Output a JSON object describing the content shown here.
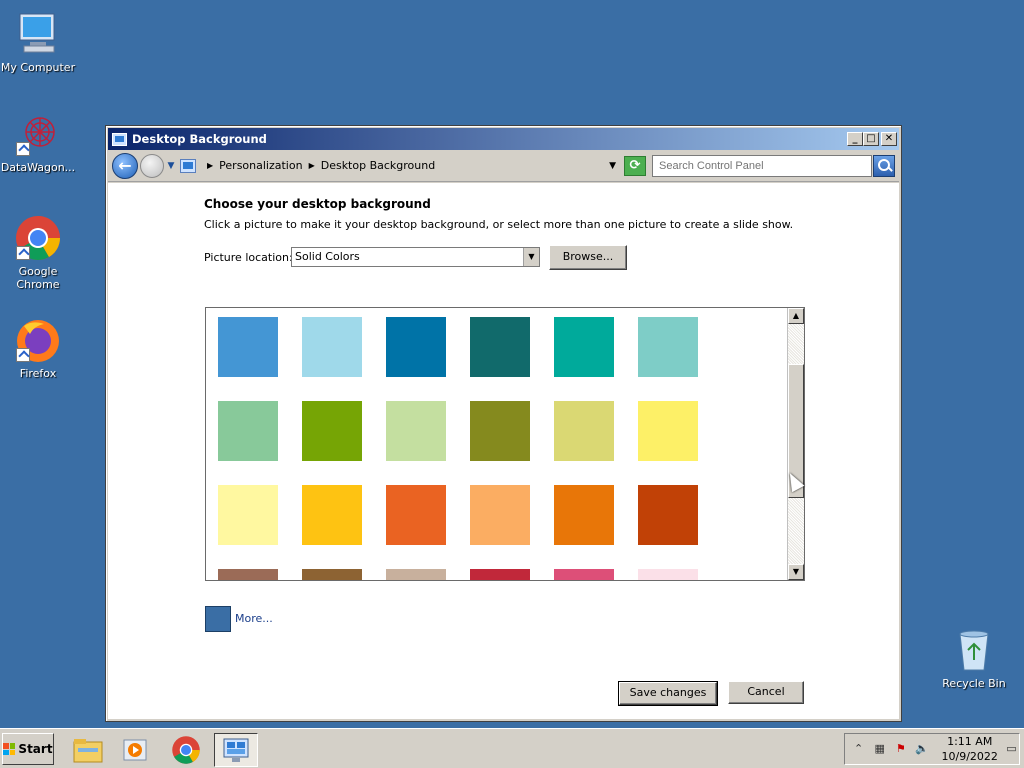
{
  "desktop": {
    "icons": [
      {
        "label": "My Computer"
      },
      {
        "label": "DataWagon..."
      },
      {
        "label": "Google Chrome"
      },
      {
        "label": "Firefox"
      },
      {
        "label": "Recycle Bin"
      }
    ]
  },
  "window": {
    "title": "Desktop Background",
    "title_buttons": {
      "minimize": "_",
      "maximize": "□",
      "close": "✕"
    },
    "breadcrumb": [
      "Personalization",
      "Desktop Background"
    ],
    "search_placeholder": "Search Control Panel",
    "heading": "Choose your desktop background",
    "subtext": "Click a picture to make it your desktop background, or select more than one picture to create a slide show.",
    "location_label": "Picture location:",
    "location_value": "Solid Colors",
    "browse_label": "Browse...",
    "swatches": [
      {
        "color": "#4496d4"
      },
      {
        "color": "#9fd9ea"
      },
      {
        "color": "#0073a7"
      },
      {
        "color": "#116a6b"
      },
      {
        "color": "#00aa9b"
      },
      {
        "color": "#7ecdc7"
      },
      {
        "color": "#88c99a"
      },
      {
        "color": "#76a505"
      },
      {
        "color": "#c4dfa0"
      },
      {
        "color": "#858a1e"
      },
      {
        "color": "#dad873"
      },
      {
        "color": "#fdf067"
      },
      {
        "color": "#fff8a0"
      },
      {
        "color": "#fec312"
      },
      {
        "color": "#ea6322"
      },
      {
        "color": "#fbad62"
      },
      {
        "color": "#e87608"
      },
      {
        "color": "#c14106"
      },
      {
        "color": "#9b6b57"
      },
      {
        "color": "#8d6333"
      },
      {
        "color": "#c8b09d"
      },
      {
        "color": "#c1283a"
      },
      {
        "color": "#dd4f78"
      },
      {
        "color": "#fbe0e8"
      }
    ],
    "more_color": "#3a6ea5",
    "more_label": "More...",
    "save_label": "Save changes",
    "cancel_label": "Cancel"
  },
  "taskbar": {
    "start_label": "Start",
    "clock_time": "1:11 AM",
    "clock_date": "10/9/2022"
  }
}
